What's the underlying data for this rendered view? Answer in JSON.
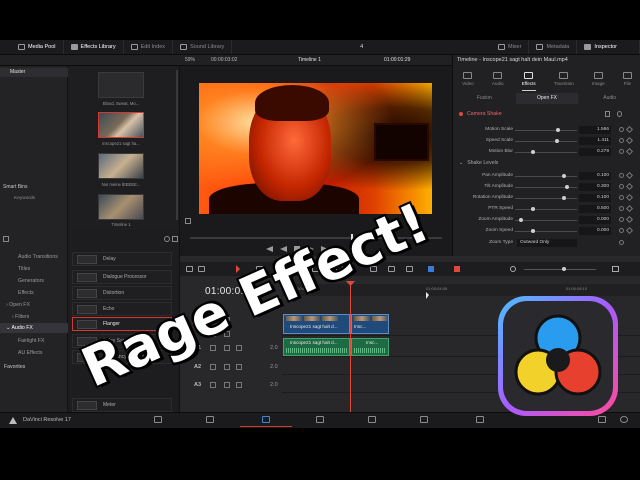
{
  "app": {
    "name": "DaVinci Resolve 17"
  },
  "topbar": {
    "media_pool": "Media Pool",
    "effects_library": "Effects Library",
    "edit_index": "Edit Index",
    "sound_library": "Sound Library",
    "count": "4",
    "mixer": "Mixer",
    "metadata": "Metadata",
    "inspector": "Inspector"
  },
  "header2": {
    "zoom": "59%",
    "source_tc": "00:00:03:02",
    "timeline_name": "Timeline 1",
    "record_tc": "01:00:01:29"
  },
  "media_pool": {
    "master": "Master",
    "smart_bins": "Smart Bins",
    "keywords": "Keywords",
    "clips": [
      {
        "caption": "Blood, Sweat, Mo..."
      },
      {
        "caption": "inscope21 sagt ha..."
      },
      {
        "caption": "Nur meine lEEEEE..."
      },
      {
        "caption": "Timeline 1"
      }
    ]
  },
  "inspector": {
    "title": "Timeline - Inscope21 sagt halt dein Maul.mp4",
    "tabs": [
      {
        "label": "Video",
        "icon": "video-icon"
      },
      {
        "label": "Audio",
        "icon": "audio-icon"
      },
      {
        "label": "Effects",
        "icon": "effects-icon"
      },
      {
        "label": "Transition",
        "icon": "transition-icon"
      },
      {
        "label": "Image",
        "icon": "image-icon"
      },
      {
        "label": "File",
        "icon": "file-icon"
      }
    ],
    "subtabs": [
      "Fusion",
      "Open FX",
      "Audio"
    ],
    "effect_name": "Camera Shake",
    "params": [
      {
        "label": "Motion Scale",
        "value": "1.566",
        "level": 0.72
      },
      {
        "label": "Speed Scale",
        "value": "1.411",
        "level": 0.7
      },
      {
        "label": "Motion Blur",
        "value": "0.279",
        "level": 0.3
      }
    ],
    "section2": "Shake Levels",
    "params2": [
      {
        "label": "Pan Amplitude",
        "value": "0.100",
        "level": 0.82
      },
      {
        "label": "Tilt Amplitude",
        "value": "0.300",
        "level": 0.86
      },
      {
        "label": "Rotation Amplitude",
        "value": "0.100",
        "level": 0.82
      },
      {
        "label": "PTR Speed",
        "value": "0.500",
        "level": 0.3
      },
      {
        "label": "Zoom Amplitude",
        "value": "0.000",
        "level": 0.1
      },
      {
        "label": "Zoom Speed",
        "value": "0.000",
        "level": 0.3
      }
    ],
    "zoom_type_label": "Zoom Type",
    "zoom_type_value": "Outward Only"
  },
  "effects": {
    "tree": [
      "Audio Transitions",
      "Titles",
      "Generators",
      "Effects",
      "Open FX",
      "Filters",
      "Audio FX",
      "Fairlight FX",
      "AU Effects",
      "Favorites"
    ],
    "items": [
      "Delay",
      "Dialogue Processor",
      "Distortion",
      "Echo",
      "Flanger",
      "Foley Sampler",
      "Frequency Analyzer",
      "Meter"
    ]
  },
  "timeline": {
    "timecode": "01:00:01:29",
    "ruler_labels": [
      "01:00:00:00",
      "01:00:04:05",
      "01:00:08:10"
    ],
    "tracks": [
      {
        "id": "V1",
        "num": ""
      },
      {
        "id": "A1",
        "num": "2.0"
      },
      {
        "id": "A2",
        "num": "2.0"
      },
      {
        "id": "A3",
        "num": "2.0"
      }
    ],
    "clips": {
      "video1": "Inscope21 sagt halt d...",
      "video2": "Insc...",
      "audio1": "Inscope21 sagt halt d...",
      "audio2": "Insc..."
    }
  },
  "overlay": {
    "title": "Rage Effect!"
  },
  "colors": {
    "accent_red": "#d23a2f",
    "video_clip": "#1f4a7a",
    "audio_clip": "#1e6a42"
  }
}
